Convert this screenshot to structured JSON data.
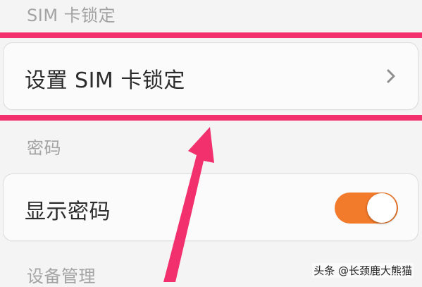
{
  "sections": {
    "sim_lock_header": "SIM 卡锁定",
    "password_header": "密码",
    "device_header": "设备管理"
  },
  "items": {
    "sim_lock_setting": {
      "label": "设置 SIM 卡锁定",
      "icon": "chevron-right-icon"
    },
    "show_password": {
      "label": "显示密码",
      "toggle_on": true
    }
  },
  "annotation": {
    "highlight_color": "#f2306e",
    "arrow_color": "#f2306e"
  },
  "watermark": "头条 @长颈鹿大熊猫",
  "colors": {
    "background": "#f4f4f4",
    "card": "#fbfbfb",
    "toggle_on": "#f27a2b",
    "section_text": "#a3a3a3"
  }
}
